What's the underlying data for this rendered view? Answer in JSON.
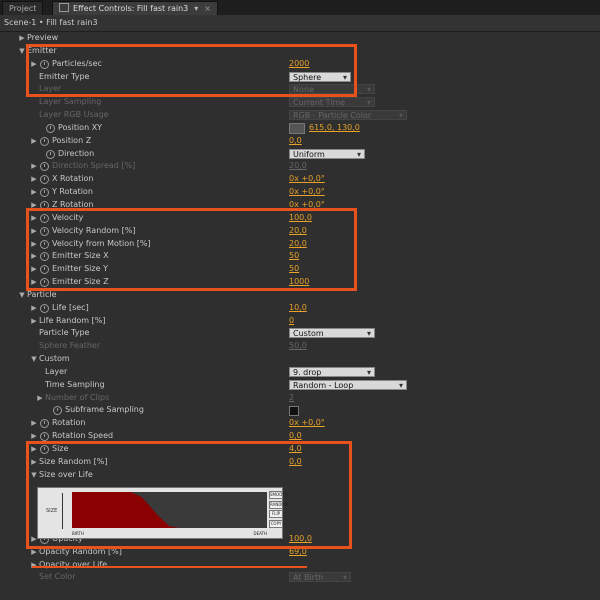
{
  "tabs": {
    "project": "Project",
    "effect_controls": "Effect Controls: Fill fast rain3",
    "dropdown_glyph": "▾",
    "close_glyph": "×"
  },
  "breadcrumb": "Scene-1 • Fill fast rain3",
  "rows": [
    {
      "label": "Preview",
      "tri": "▶",
      "indent": 0
    },
    {
      "label": "Emitter",
      "tri": "▼",
      "indent": 0
    },
    {
      "label": "Particles/sec",
      "tri": "▶",
      "sw": true,
      "indent": 2,
      "value": "2000"
    },
    {
      "label": "Emitter Type",
      "indent": 2,
      "select": "Sphere"
    },
    {
      "label": "Layer",
      "indent": 2,
      "select": "None",
      "dim": true
    },
    {
      "label": "Layer Sampling",
      "indent": 2,
      "select": "Current Time",
      "dim": true
    },
    {
      "label": "Layer RGB Usage",
      "indent": 2,
      "select": "RGB - Particle Color",
      "dim": true
    },
    {
      "label": "Position XY",
      "sw": true,
      "indent": 3,
      "target": true,
      "value": "615,0, 130,0"
    },
    {
      "label": "Position Z",
      "tri": "▶",
      "sw": true,
      "indent": 2,
      "value": "0,0"
    },
    {
      "label": "Direction",
      "sw": true,
      "indent": 3,
      "select": "Uniform"
    },
    {
      "label": "Direction Spread [%]",
      "tri": "▶",
      "sw": true,
      "indent": 2,
      "value": "20,0",
      "dim": true
    },
    {
      "label": "X Rotation",
      "tri": "▶",
      "sw": true,
      "indent": 2,
      "value": "0x +0,0°"
    },
    {
      "label": "Y Rotation",
      "tri": "▶",
      "sw": true,
      "indent": 2,
      "value": "0x +0,0°"
    },
    {
      "label": "Z Rotation",
      "tri": "▶",
      "sw": true,
      "indent": 2,
      "value": "0x +0,0°"
    },
    {
      "label": "Velocity",
      "tri": "▶",
      "sw": true,
      "indent": 2,
      "value": "100,0"
    },
    {
      "label": "Velocity Random [%]",
      "tri": "▶",
      "sw": true,
      "indent": 2,
      "value": "20,0"
    },
    {
      "label": "Velocity from Motion [%]",
      "tri": "▶",
      "sw": true,
      "indent": 2,
      "value": "20,0"
    },
    {
      "label": "Emitter Size X",
      "tri": "▶",
      "sw": true,
      "indent": 2,
      "value": "50"
    },
    {
      "label": "Emitter Size Y",
      "tri": "▶",
      "sw": true,
      "indent": 2,
      "value": "50"
    },
    {
      "label": "Emitter Size Z",
      "tri": "▶",
      "sw": true,
      "indent": 2,
      "value": "1000"
    },
    {
      "label": "Particle",
      "tri": "▼",
      "indent": 0
    },
    {
      "label": "Life [sec]",
      "tri": "▶",
      "sw": true,
      "indent": 2,
      "value": "10,0"
    },
    {
      "label": "Life Random [%]",
      "tri": "▶",
      "indent": 2,
      "value": "0"
    },
    {
      "label": "Particle Type",
      "indent": 2,
      "select": "Custom"
    },
    {
      "label": "Sphere Feather",
      "indent": 2,
      "value": "50,0",
      "dim": true
    },
    {
      "label": "Custom",
      "tri": "▼",
      "indent": 2
    },
    {
      "label": "Layer",
      "indent": 3,
      "select": "9. drop"
    },
    {
      "label": "Time Sampling",
      "indent": 3,
      "select": "Random - Loop"
    },
    {
      "label": "Number of Clips",
      "tri": "▶",
      "indent": 3,
      "value": "2",
      "dim": true
    },
    {
      "label": "Subframe Sampling",
      "sw": true,
      "indent": 4,
      "check": true
    },
    {
      "label": "Rotation",
      "tri": "▶",
      "sw": true,
      "indent": 2,
      "value": "0x +0,0°"
    },
    {
      "label": "Rotation Speed",
      "tri": "▶",
      "sw": true,
      "indent": 2,
      "value": "0,0"
    },
    {
      "label": "Size",
      "tri": "▶",
      "sw": true,
      "indent": 2,
      "value": "4,0"
    },
    {
      "label": "Size Random [%]",
      "tri": "▶",
      "indent": 2,
      "value": "0,0"
    },
    {
      "label": "Size over Life",
      "tri": "▼",
      "indent": 2
    },
    {
      "label": "",
      "indent": 2,
      "spacer": true
    },
    {
      "label": "",
      "indent": 2,
      "spacer": true
    },
    {
      "label": "",
      "indent": 2,
      "spacer": true
    },
    {
      "label": "",
      "indent": 2,
      "spacer": true
    },
    {
      "label": "Opacity",
      "tri": "▶",
      "sw": true,
      "indent": 2,
      "value": "100,0"
    },
    {
      "label": "Opacity Random [%]",
      "tri": "▶",
      "indent": 2,
      "value": "69,0"
    },
    {
      "label": "Opacity over Life",
      "tri": "▶",
      "indent": 2
    },
    {
      "label": "Set Color",
      "indent": 2,
      "select": "At Birth",
      "dim": true
    }
  ],
  "size_over_life": {
    "axis_label": "SIZE",
    "foot_left": "BIRTH",
    "foot_right": "DEATH",
    "buttons": [
      "SMOOTH",
      "RANDOM",
      "FLIP",
      "COPY"
    ],
    "curve": [
      [
        0,
        1
      ],
      [
        0.3,
        1
      ],
      [
        0.36,
        0.85
      ],
      [
        0.44,
        0.35
      ],
      [
        0.5,
        0.05
      ],
      [
        0.55,
        0
      ],
      [
        1,
        0
      ]
    ]
  },
  "colors": {
    "highlight": "#e8531d",
    "value": "#e8a22a",
    "curve_fill": "#8b0000"
  }
}
